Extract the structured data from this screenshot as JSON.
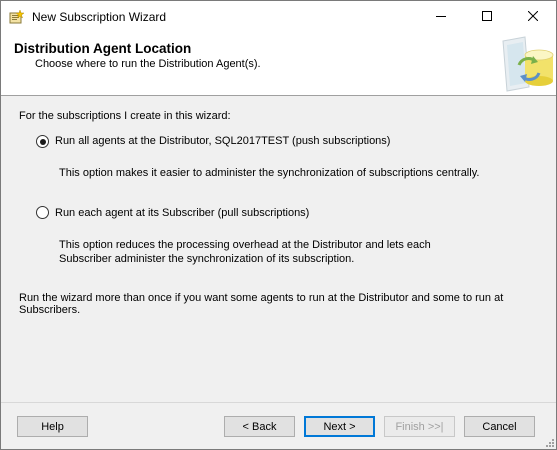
{
  "window": {
    "title": "New Subscription Wizard",
    "icon": "wizard-icon",
    "controls": [
      "minimize-icon",
      "maximize-icon",
      "close-icon"
    ]
  },
  "header": {
    "title": "Distribution Agent Location",
    "subtitle": "Choose where to run the Distribution Agent(s).",
    "graphic": "database-sync-graphic"
  },
  "body": {
    "intro": "For the subscriptions I create in this wizard:",
    "options": [
      {
        "label": "Run all agents at the Distributor, SQL2017TEST (push subscriptions)",
        "selected": true,
        "description": [
          "This option makes it easier to administer the synchronization of subscriptions centrally."
        ]
      },
      {
        "label": "Run each agent at its Subscriber (pull subscriptions)",
        "selected": false,
        "description": [
          "This option reduces the processing overhead at the Distributor and lets each",
          "Subscriber administer the synchronization of its subscription."
        ]
      }
    ],
    "note": [
      "Run the wizard more than once if you want some agents to run at the Distributor and some to run at",
      "Subscribers."
    ]
  },
  "buttons": {
    "help": "Help",
    "back": "< Back",
    "next": "Next >",
    "finish": "Finish >>|",
    "cancel": "Cancel"
  },
  "colors": {
    "accent": "#0078d7",
    "window_bg": "#f0f0f0",
    "header_bg": "#ffffff",
    "disabled_text": "#a0a0a0"
  }
}
